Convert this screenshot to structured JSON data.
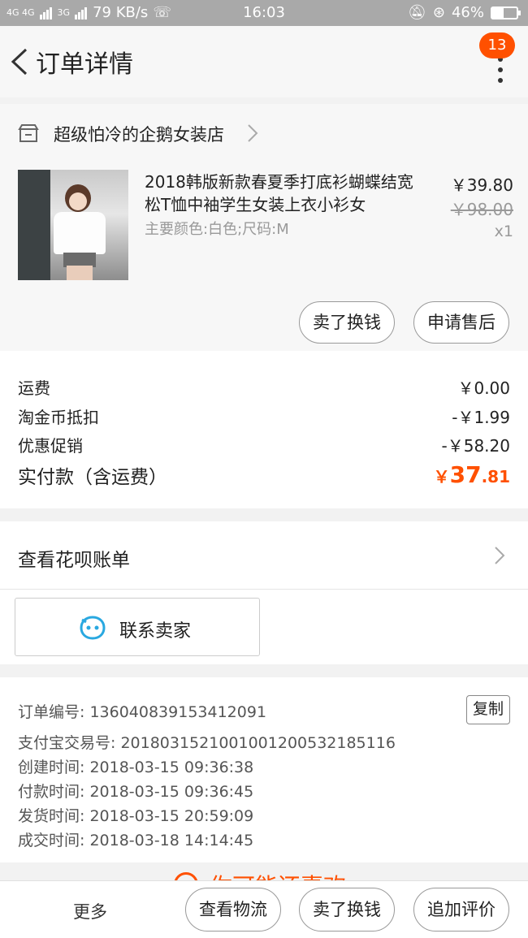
{
  "status_bar": {
    "network": "4G 4G",
    "network2": "3G",
    "speed": "79 KB/s",
    "time": "16:03",
    "battery": "46%",
    "battery_level": 0.46
  },
  "header": {
    "title": "订单详情",
    "badge_count": "13"
  },
  "store": {
    "name": "超级怕冷的企鹅女装店"
  },
  "product": {
    "title": "2018韩版新款春夏季打底衫蝴蝶结宽松T恤中袖学生女装上衣小衫女",
    "spec": "主要颜色:白色;尺码:M",
    "price": "￥39.80",
    "original_price": "￥98.00",
    "quantity": "x1",
    "actions": {
      "sell": "卖了换钱",
      "after_sale": "申请售后"
    }
  },
  "fees": {
    "shipping": {
      "label": "运费",
      "value": "￥0.00"
    },
    "taojinbi": {
      "label": "淘金币抵扣",
      "value": "-￥1.99"
    },
    "promo": {
      "label": "优惠促销",
      "value": "-￥58.20"
    },
    "total": {
      "label": "实付款（含运费）",
      "currency": "￥",
      "int": "37",
      "dec": ".81"
    }
  },
  "huabei": {
    "label": "查看花呗账单"
  },
  "contact": {
    "label": "联系卖家"
  },
  "order_info": {
    "order_no": "订单编号: 136040839153412091",
    "copy_label": "复制",
    "alipay_no": "支付宝交易号: 2018031521001001200532185116",
    "created": "创建时间: 2018-03-15 09:36:38",
    "paid": "付款时间: 2018-03-15 09:36:45",
    "shipped": "发货时间: 2018-03-15 20:59:09",
    "completed": "成交时间: 2018-03-18 14:14:45"
  },
  "promo_peek": {
    "text": "你可能还喜欢"
  },
  "bottom_bar": {
    "more": "更多",
    "logistics": "查看物流",
    "sell": "卖了换钱",
    "review": "追加评价"
  },
  "colors": {
    "accent": "#ff5000",
    "chat_icon": "#29a8e0"
  }
}
